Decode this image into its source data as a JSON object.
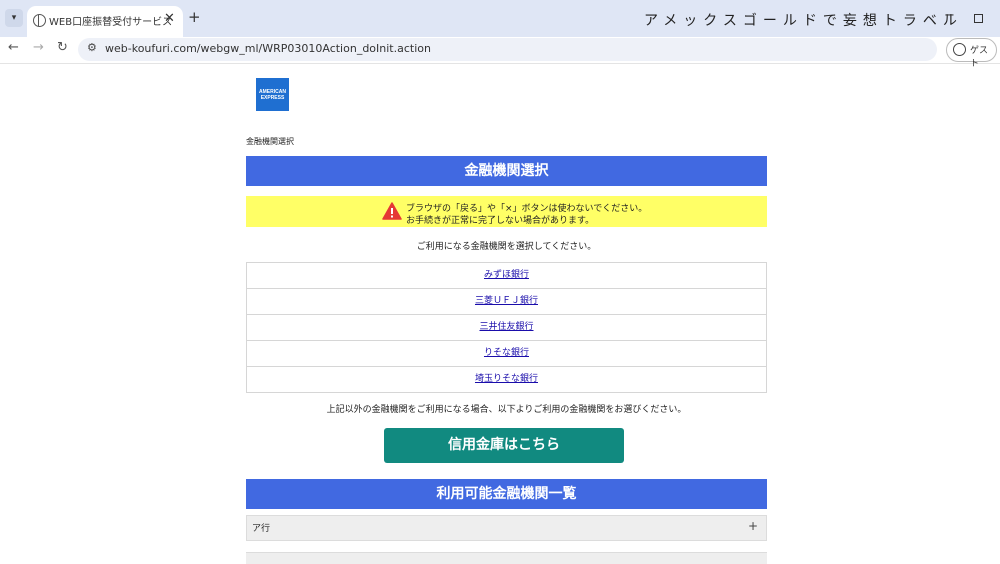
{
  "browser": {
    "tab_title": "WEB口座振替受付サービス",
    "window_title": "アメックスゴールドで妄想トラベル",
    "url": "web-koufuri.com/webgw_ml/WRP03010Action_doInit.action",
    "profile_label": "ゲスト"
  },
  "page": {
    "logo": [
      "AMERICAN",
      "EXPRESS"
    ],
    "breadcrumb": "金融機関選択",
    "header": "金融機関選択",
    "warning": {
      "line1": "ブラウザの「戻る」や「×」ボタンは使わないでください。",
      "line2": "お手続きが正常に完了しない場合があります。"
    },
    "instruction": "ご利用になる金融機関を選択してください。",
    "banks": [
      "みずほ銀行",
      "三菱ＵＦＪ銀行",
      "三井住友銀行",
      "りそな銀行",
      "埼玉りそな銀行"
    ],
    "other_note": "上記以外の金融機関をご利用になる場合、以下よりご利用の金融機関をお選びください。",
    "shinkin_button": "信用金庫はこちら",
    "list_header": "利用可能金融機関一覧",
    "accordion_label": "ア行",
    "accordion_toggle": "+"
  },
  "colors": {
    "header_blue": "#4169e1",
    "warning_yellow": "#ffff66",
    "button_teal": "#118a80"
  }
}
